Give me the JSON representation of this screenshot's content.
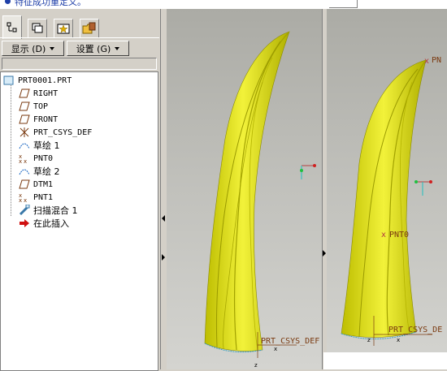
{
  "message_bar": {
    "text": "特征成功重定义。"
  },
  "tabs": [
    {
      "name": "model-tree-tab",
      "icon": "model-tree-icon"
    },
    {
      "name": "layers-tab",
      "icon": "layers-icon"
    },
    {
      "name": "favorites-tab",
      "icon": "favorites-icon"
    },
    {
      "name": "folder-tab",
      "icon": "folder-browser-icon"
    }
  ],
  "toolbar": {
    "display_label": "显示 (D)",
    "settings_label": "设置 (G)"
  },
  "model_tree": {
    "items": [
      {
        "label": "PRT0001.PRT",
        "icon": "part-icon"
      },
      {
        "label": "RIGHT",
        "icon": "datum-plane-icon"
      },
      {
        "label": "TOP",
        "icon": "datum-plane-icon"
      },
      {
        "label": "FRONT",
        "icon": "datum-plane-icon"
      },
      {
        "label": "PRT_CSYS_DEF",
        "icon": "csys-icon"
      },
      {
        "label": "草绘 1",
        "icon": "sketch-icon"
      },
      {
        "label": "PNT0",
        "icon": "datum-point-icon"
      },
      {
        "label": "草绘 2",
        "icon": "sketch-icon"
      },
      {
        "label": "DTM1",
        "icon": "datum-plane-icon"
      },
      {
        "label": "PNT1",
        "icon": "datum-point-icon"
      },
      {
        "label": "扫描混合 1",
        "icon": "swept-blend-icon"
      },
      {
        "label": "在此插入",
        "icon": "insert-here-arrow-icon"
      }
    ]
  },
  "viewport1": {
    "csys_label": "PRT_CSYS_DEF",
    "axis_x": "x",
    "axis_z": "z"
  },
  "viewport2": {
    "point_top_label": "PN",
    "point_mid_label": "PNT0",
    "csys_label": "PRT_CSYS_DE",
    "axis_x": "x",
    "axis_z": "z"
  },
  "colors": {
    "model": "#e6e619",
    "model_shade": "#a7a700",
    "point": "#b44040",
    "msg": "#1f3fa8"
  }
}
